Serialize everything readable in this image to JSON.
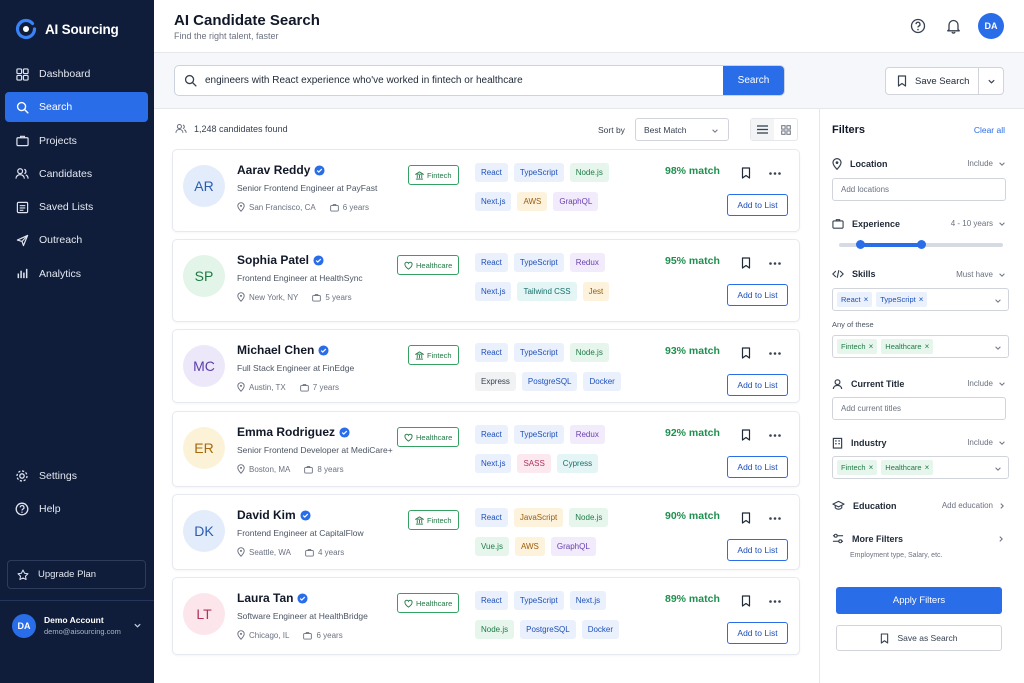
{
  "app": {
    "name": "AI Sourcing"
  },
  "colors": {
    "sidebar": "#0f1d3a",
    "accent": "#2a6de9",
    "match": "#1f8f4f",
    "industry": "#34a062"
  },
  "nav": {
    "items": [
      {
        "label": "Dashboard",
        "icon": "grid-icon"
      },
      {
        "label": "Search",
        "icon": "search-icon",
        "active": true
      },
      {
        "label": "Projects",
        "icon": "briefcase-icon"
      },
      {
        "label": "Candidates",
        "icon": "users-icon"
      },
      {
        "label": "Saved Lists",
        "icon": "list-icon"
      },
      {
        "label": "Outreach",
        "icon": "send-icon"
      },
      {
        "label": "Analytics",
        "icon": "bar-chart-icon"
      }
    ],
    "bottom": [
      {
        "label": "Settings",
        "icon": "gear-icon"
      },
      {
        "label": "Help",
        "icon": "help-icon"
      }
    ],
    "upgrade_label": "Upgrade Plan"
  },
  "account": {
    "initials": "DA",
    "name": "Demo Account",
    "email": "demo@aisourcing.com"
  },
  "header": {
    "title": "AI Candidate Search",
    "subtitle": "Find the right talent, faster",
    "avatar": "DA"
  },
  "search": {
    "query": "engineers with React experience who've worked in fintech or healthcare",
    "button_label": "Search",
    "save_label": "Save Search"
  },
  "results": {
    "count_text": "1,248 candidates found",
    "sort_label": "Sort by",
    "sort_value": "Best Match",
    "add_label": "Add to List",
    "candidates": [
      {
        "initials": "AR",
        "name": "Aarav Reddy",
        "role": "Senior Frontend Engineer at PayFast",
        "location": "San Francisco, CA",
        "experience": "6 years",
        "industry": "Fintech",
        "skills_row1": [
          {
            "name": "React",
            "color": "blue"
          },
          {
            "name": "TypeScript",
            "color": "blue"
          },
          {
            "name": "Node.js",
            "color": "green"
          }
        ],
        "skills_row2": [
          {
            "name": "Next.js",
            "color": "blue"
          },
          {
            "name": "AWS",
            "color": "orange"
          },
          {
            "name": "GraphQL",
            "color": "purple"
          }
        ],
        "match": "98% match",
        "avatar_bg": "#e3ecfb",
        "avatar_fg": "#2a5db0"
      },
      {
        "initials": "SP",
        "name": "Sophia Patel",
        "role": "Frontend Engineer at HealthSync",
        "location": "New York, NY",
        "experience": "5 years",
        "industry": "Healthcare",
        "skills_row1": [
          {
            "name": "React",
            "color": "blue"
          },
          {
            "name": "TypeScript",
            "color": "blue"
          },
          {
            "name": "Redux",
            "color": "purple"
          }
        ],
        "skills_row2": [
          {
            "name": "Next.js",
            "color": "blue"
          },
          {
            "name": "Tailwind CSS",
            "color": "teal"
          },
          {
            "name": "Jest",
            "color": "orange"
          }
        ],
        "match": "95% match",
        "avatar_bg": "#e3f4e9",
        "avatar_fg": "#1f7a45"
      },
      {
        "initials": "MC",
        "name": "Michael Chen",
        "role": "Full Stack Engineer at FinEdge",
        "location": "Austin, TX",
        "experience": "7 years",
        "industry": "Fintech",
        "skills_row1": [
          {
            "name": "React",
            "color": "blue"
          },
          {
            "name": "TypeScript",
            "color": "blue"
          },
          {
            "name": "Node.js",
            "color": "green"
          }
        ],
        "skills_row2": [
          {
            "name": "Express",
            "color": "gray"
          },
          {
            "name": "PostgreSQL",
            "color": "blue"
          },
          {
            "name": "Docker",
            "color": "blue"
          }
        ],
        "match": "93% match",
        "avatar_bg": "#ece8fa",
        "avatar_fg": "#5b3fa8"
      },
      {
        "initials": "ER",
        "name": "Emma Rodriguez",
        "role": "Senior Frontend Developer at MediCare+",
        "location": "Boston, MA",
        "experience": "8 years",
        "industry": "Healthcare",
        "skills_row1": [
          {
            "name": "React",
            "color": "blue"
          },
          {
            "name": "TypeScript",
            "color": "blue"
          },
          {
            "name": "Redux",
            "color": "purple"
          }
        ],
        "skills_row2": [
          {
            "name": "Next.js",
            "color": "blue"
          },
          {
            "name": "SASS",
            "color": "pink"
          },
          {
            "name": "Cypress",
            "color": "teal"
          }
        ],
        "match": "92% match",
        "avatar_bg": "#fcf2d8",
        "avatar_fg": "#a8690d"
      },
      {
        "initials": "DK",
        "name": "David Kim",
        "role": "Frontend Engineer at CapitalFlow",
        "location": "Seattle, WA",
        "experience": "4 years",
        "industry": "Fintech",
        "skills_row1": [
          {
            "name": "React",
            "color": "blue"
          },
          {
            "name": "JavaScript",
            "color": "orange"
          },
          {
            "name": "Node.js",
            "color": "green"
          }
        ],
        "skills_row2": [
          {
            "name": "Vue.js",
            "color": "green"
          },
          {
            "name": "AWS",
            "color": "orange"
          },
          {
            "name": "GraphQL",
            "color": "purple"
          }
        ],
        "match": "90% match",
        "avatar_bg": "#e3ecfb",
        "avatar_fg": "#2a5db0"
      },
      {
        "initials": "LT",
        "name": "Laura Tan",
        "role": "Software Engineer at HealthBridge",
        "location": "Chicago, IL",
        "experience": "6 years",
        "industry": "Healthcare",
        "skills_row1": [
          {
            "name": "React",
            "color": "blue"
          },
          {
            "name": "TypeScript",
            "color": "blue"
          },
          {
            "name": "Next.js",
            "color": "blue"
          }
        ],
        "skills_row2": [
          {
            "name": "Node.js",
            "color": "green"
          },
          {
            "name": "PostgreSQL",
            "color": "blue"
          },
          {
            "name": "Docker",
            "color": "blue"
          }
        ],
        "match": "89% match",
        "avatar_bg": "#fce6ec",
        "avatar_fg": "#b1325d"
      }
    ]
  },
  "filters": {
    "title": "Filters",
    "clear_label": "Clear all",
    "location": {
      "label": "Location",
      "mode": "Include",
      "placeholder": "Add locations"
    },
    "experience": {
      "label": "Experience",
      "range": "4 - 10 years",
      "min_fraction": 0.13,
      "max_fraction": 0.5
    },
    "skills": {
      "label": "Skills",
      "mode": "Must have",
      "tags": [
        "React",
        "TypeScript"
      ],
      "any_label": "Any of these",
      "any_tags": [
        "Fintech",
        "Healthcare"
      ]
    },
    "current_title": {
      "label": "Current Title",
      "mode": "Include",
      "placeholder": "Add current titles"
    },
    "industry": {
      "label": "Industry",
      "mode": "Include",
      "tags": [
        "Fintech",
        "Healthcare"
      ]
    },
    "education": {
      "label": "Education",
      "action": "Add education"
    },
    "more": {
      "label": "More Filters",
      "subtitle": "Employment type, Salary, etc."
    },
    "apply_label": "Apply Filters",
    "save_label": "Save as Search"
  }
}
